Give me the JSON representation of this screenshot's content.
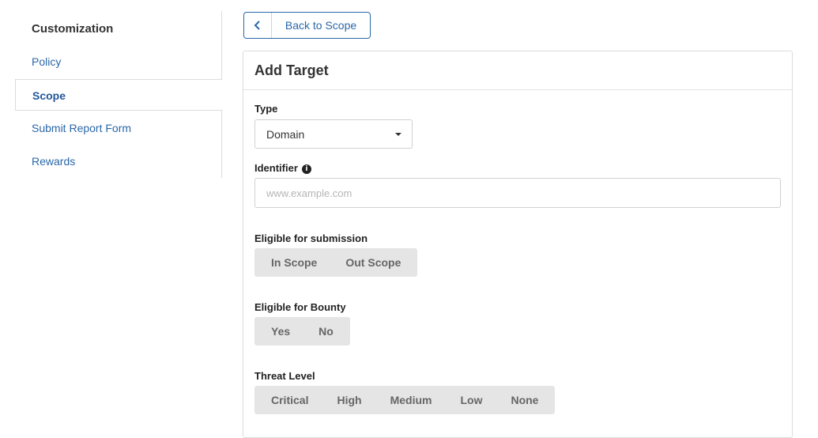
{
  "sidebar": {
    "title": "Customization",
    "items": [
      {
        "label": "Policy"
      },
      {
        "label": "Scope"
      },
      {
        "label": "Submit Report Form"
      },
      {
        "label": "Rewards"
      }
    ]
  },
  "back_button": {
    "label": "Back to Scope"
  },
  "panel": {
    "title": "Add Target",
    "type": {
      "label": "Type",
      "value": "Domain"
    },
    "identifier": {
      "label": "Identifier",
      "placeholder": "www.example.com",
      "value": ""
    },
    "eligible_submission": {
      "label": "Eligible for submission",
      "options": [
        "In Scope",
        "Out Scope"
      ]
    },
    "eligible_bounty": {
      "label": "Eligible for Bounty",
      "options": [
        "Yes",
        "No"
      ]
    },
    "threat_level": {
      "label": "Threat Level",
      "options": [
        "Critical",
        "High",
        "Medium",
        "Low",
        "None"
      ]
    }
  }
}
